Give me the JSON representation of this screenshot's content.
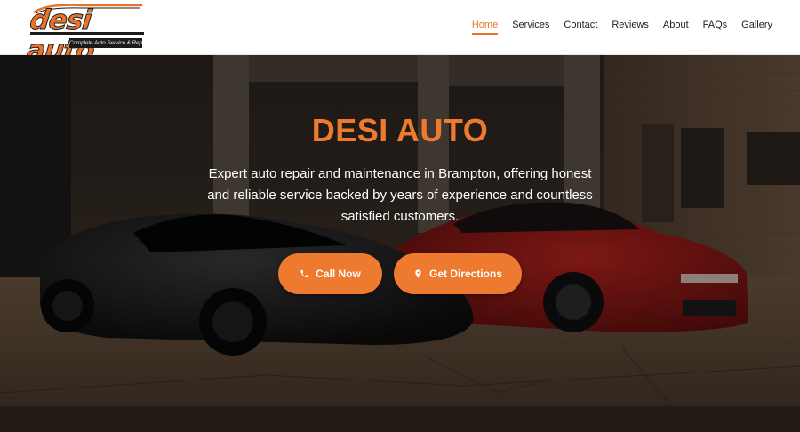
{
  "brand": {
    "logo_text": "desi auto",
    "tagline": "Complete Auto Service & Repair",
    "accent_color": "#ee7a2f"
  },
  "nav": {
    "items": [
      {
        "label": "Home",
        "active": true
      },
      {
        "label": "Services",
        "active": false
      },
      {
        "label": "Contact",
        "active": false
      },
      {
        "label": "Reviews",
        "active": false
      },
      {
        "label": "About",
        "active": false
      },
      {
        "label": "FAQs",
        "active": false
      },
      {
        "label": "Gallery",
        "active": false
      }
    ]
  },
  "hero": {
    "title": "DESI AUTO",
    "description": "Expert auto repair and maintenance in Brampton, offering honest and reliable service backed by years of experience and countless satisfied customers.",
    "buttons": {
      "call": {
        "label": "Call Now",
        "icon": "phone-icon"
      },
      "directions": {
        "label": "Get Directions",
        "icon": "map-pin-icon"
      }
    }
  }
}
